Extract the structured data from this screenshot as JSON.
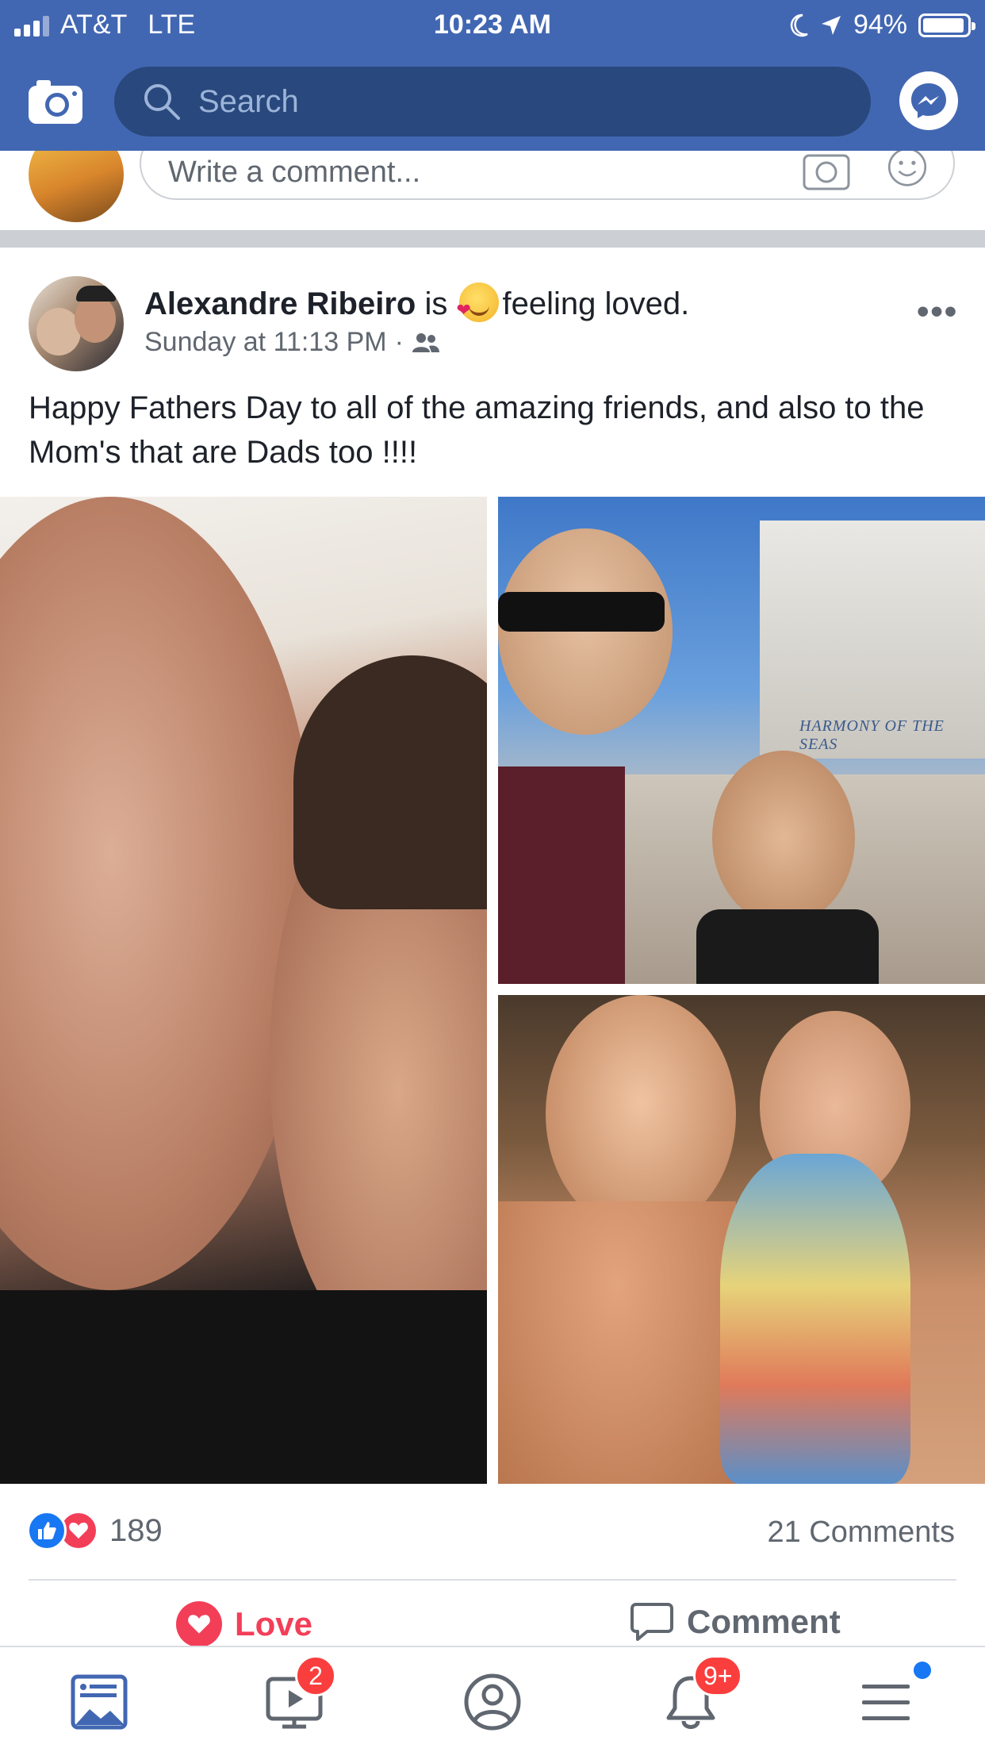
{
  "status_bar": {
    "carrier": "AT&T",
    "network": "LTE",
    "time": "10:23 AM",
    "battery": "94%"
  },
  "header": {
    "search_placeholder": "Search"
  },
  "comment_strip": {
    "placeholder": "Write a comment..."
  },
  "post": {
    "author": "Alexandre Ribeiro",
    "is_word": "is",
    "feeling": "feeling loved.",
    "timestamp": "Sunday at 11:13 PM",
    "separator": "·",
    "more": "•••",
    "text": "Happy Fathers Day to all of the amazing friends, and also to the Mom's that are Dads too !!!!",
    "photo2_caption": "HARMONY OF THE SEAS",
    "reaction_count": "189",
    "comments_count": "21 Comments",
    "love_label": "Love",
    "comment_label": "Comment"
  },
  "tabs": {
    "watch_badge": "2",
    "notifications_badge": "9+"
  },
  "colors": {
    "brand": "#4267b2",
    "search_bg": "#29487d",
    "love": "#f33e58",
    "like": "#1877f2",
    "badge": "#fa3e3e"
  },
  "icons": [
    "camera-icon",
    "search-icon",
    "messenger-icon",
    "people-icon",
    "like-reaction-icon",
    "love-reaction-icon",
    "comment-icon",
    "news-feed-icon",
    "watch-icon",
    "profile-icon",
    "bell-icon",
    "menu-icon"
  ]
}
